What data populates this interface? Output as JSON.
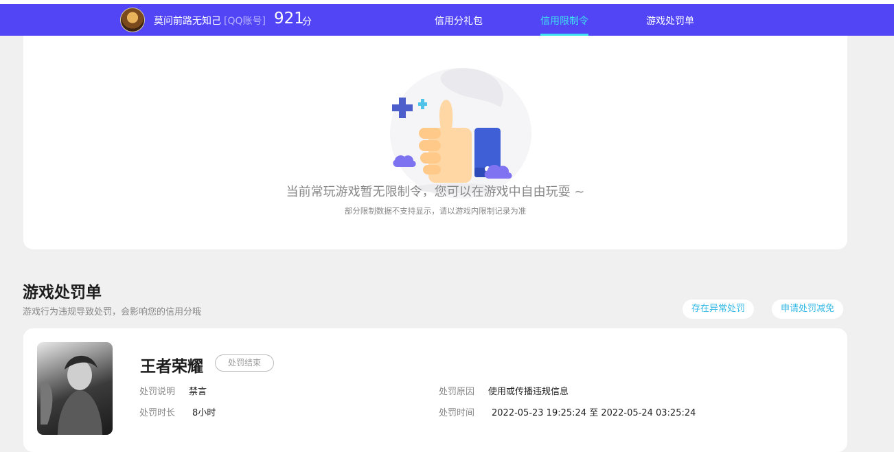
{
  "header": {
    "username": "莫问前路无知己",
    "account_type": "[QQ账号]",
    "score": "921",
    "score_unit": "分",
    "tabs": [
      {
        "label": "信用分礼包",
        "active": false
      },
      {
        "label": "信用限制令",
        "active": true
      },
      {
        "label": "游戏处罚单",
        "active": false
      }
    ]
  },
  "restriction": {
    "empty_title": "当前常玩游戏暂无限制令，您可以在游戏中自由玩耍 ~",
    "empty_note": "部分限制数据不支持显示，请以游戏内限制记录为准",
    "illustration_icon": "thumbs-up-icon"
  },
  "penalty": {
    "title": "游戏处罚单",
    "subtitle": "游戏行为违规导致处罚，会影响您的信用分哦",
    "buttons": [
      "存在异常处罚",
      "申请处罚减免"
    ],
    "record": {
      "game": "王者荣耀",
      "status": "处罚结束",
      "desc_label": "处罚说明",
      "desc_value": "禁言",
      "duration_label": "处罚时长",
      "duration_value": "8小时",
      "reason_label": "处罚原因",
      "reason_value": "使用或传播违规信息",
      "time_label": "处罚时间",
      "time_value": "2022-05-23 19:25:24 至 2022-05-24 03:25:24"
    }
  },
  "colors": {
    "nav_bg": "#5145f6",
    "accent": "#3ee0f0",
    "link": "#32b8e6"
  }
}
